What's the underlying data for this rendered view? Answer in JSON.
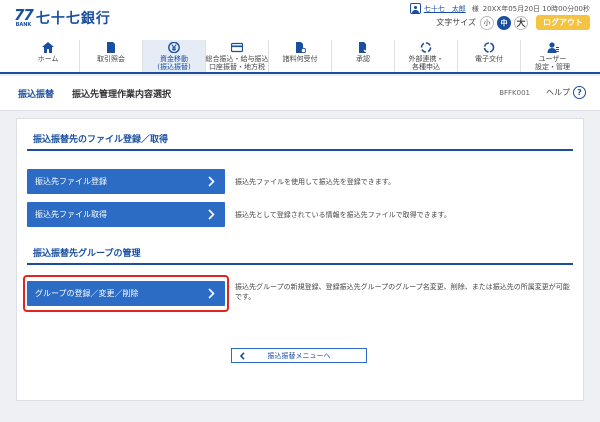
{
  "header": {
    "logo_mark": "77",
    "logo_bank": "BANK",
    "logo_text": "七十七銀行",
    "user_name": "七十七　太郎",
    "honorific": "様",
    "login_datetime": "20XX年05月20日 10時00分00秒",
    "font_size_label": "文字サイズ",
    "font_sizes": [
      "小",
      "中",
      "大"
    ],
    "logout_label": "ログアウト"
  },
  "nav": {
    "items": [
      {
        "label1": "ホーム",
        "label2": "",
        "icon": "home-icon"
      },
      {
        "label1": "取引照会",
        "label2": "",
        "icon": "document-icon"
      },
      {
        "label1": "資金移動",
        "label2": "(振込振替)",
        "icon": "yen-icon"
      },
      {
        "label1": "総合振込・給与振込",
        "label2": "口座振替・地方税",
        "icon": "card-icon"
      },
      {
        "label1": "諸料何受付",
        "label2": "",
        "icon": "document-user-icon"
      },
      {
        "label1": "承認",
        "label2": "",
        "icon": "approve-icon"
      },
      {
        "label1": "外部連携・",
        "label2": "各種申込",
        "icon": "link-icon"
      },
      {
        "label1": "電子交付",
        "label2": "",
        "icon": "refresh-icon"
      },
      {
        "label1": "ユーザー",
        "label2": "設定・管理",
        "icon": "user-settings-icon"
      }
    ]
  },
  "page": {
    "category": "振込振替",
    "title": "振込先管理作業内容選択",
    "screen_id": "BFFK001",
    "help_label": "ヘルプ",
    "help_icon": "?"
  },
  "sections": {
    "file": {
      "title": "振込振替先のファイル登録／取得",
      "register_label": "振込先ファイル登録",
      "register_desc": "振込先ファイルを使用して振込先を登録できます。",
      "acquire_label": "振込先ファイル取得",
      "acquire_desc": "振込先として登録されている情報を振込先ファイルで取得できます。"
    },
    "group": {
      "title": "振込振替先グループの管理",
      "manage_label": "グループの登録／変更／削除",
      "manage_desc": "振込先グループの新規登録、登録振込先グループのグループ名変更、削除、または振込先の所属変更が可能です。"
    }
  },
  "back_label": "振込振替メニューへ",
  "colors": {
    "brand": "#1a4fa0",
    "button": "#2d6cc4",
    "logout": "#f5c242",
    "highlight": "#e0251f"
  }
}
